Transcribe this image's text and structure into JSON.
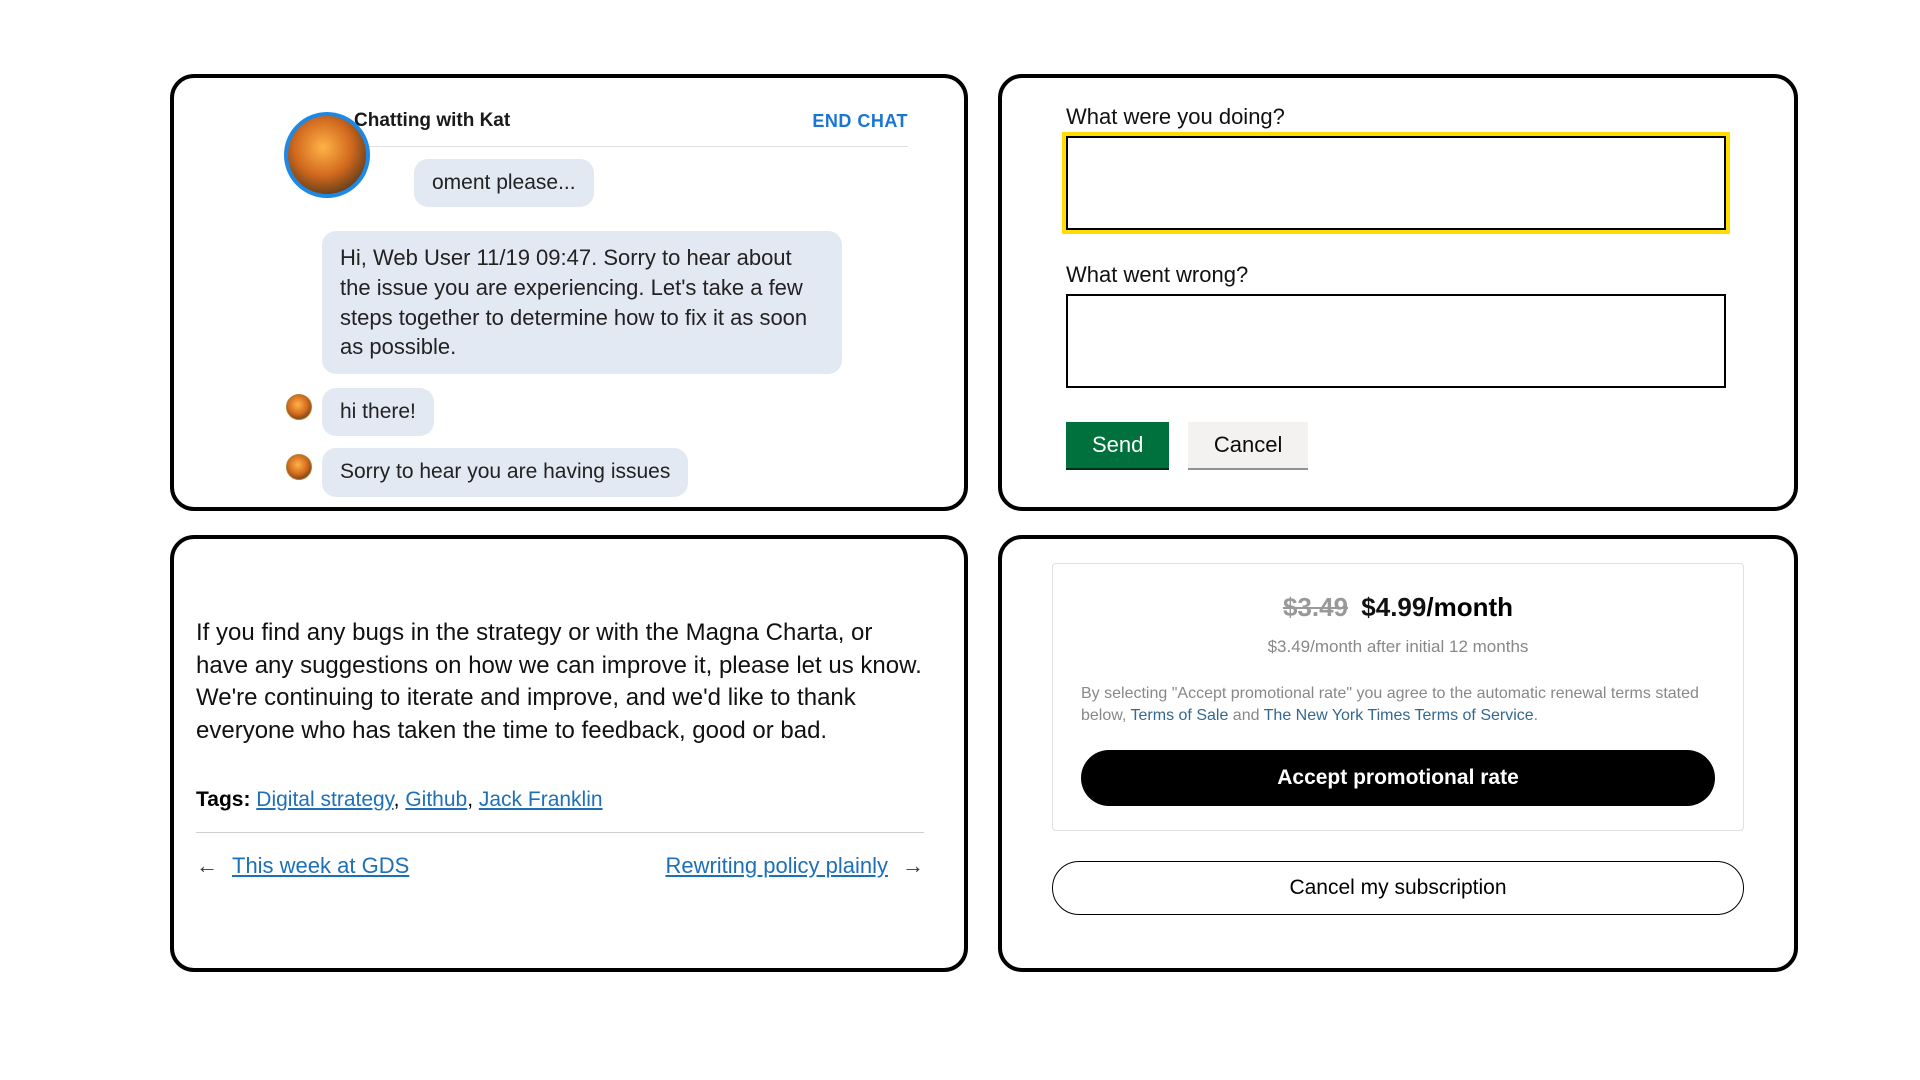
{
  "chat": {
    "title": "Chatting with Kat",
    "end_chat": "END CHAT",
    "messages": [
      {
        "text": "oment please..."
      },
      {
        "text": "Hi, Web User 11/19 09:47. Sorry to hear about the issue you are experiencing. Let's take a few steps together to determine how to fix it as soon as possible."
      },
      {
        "text": "hi there!"
      },
      {
        "text": "Sorry to hear you are having issues"
      }
    ]
  },
  "form": {
    "q1_label": "What were you doing?",
    "q1_value": "",
    "q2_label": "What went wrong?",
    "q2_value": "",
    "send": "Send",
    "cancel": "Cancel"
  },
  "blog": {
    "body": "If you find any bugs in the strategy or with the Magna Charta, or have any suggestions on how we can improve it, please let us know. We're continuing to iterate and improve, and we'd like to thank everyone who has taken the time to feedback, good or bad.",
    "tags_label": "Tags:",
    "tags": [
      "Digital strategy",
      "Github",
      "Jack Franklin"
    ],
    "prev": "This week at GDS",
    "next": "Rewriting policy plainly"
  },
  "sub": {
    "old_price": "$3.49",
    "new_price": "$4.99",
    "per": "/month",
    "note": "$3.49/month after initial 12 months",
    "legal_prefix": "By selecting \"Accept promotional rate\" you agree to the automatic renewal terms stated below, ",
    "tos1": "Terms of Sale",
    "legal_and": " and ",
    "tos2": "The New York Times Terms of Service",
    "legal_period": ".",
    "accept": "Accept promotional rate",
    "cancel": "Cancel my subscription"
  }
}
